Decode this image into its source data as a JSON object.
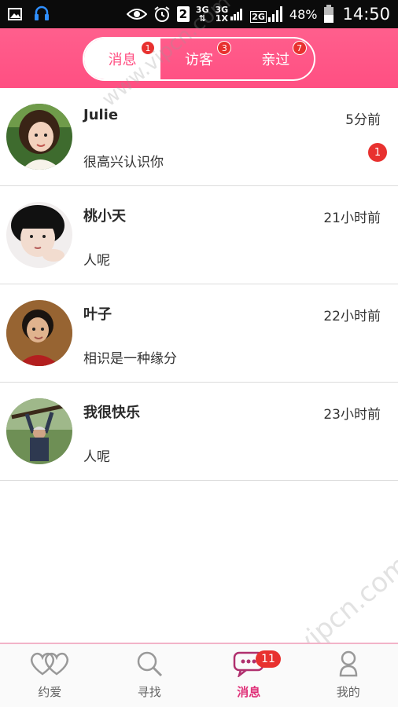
{
  "status_bar": {
    "network_3g_a": "3G",
    "network_3g_b": "3G",
    "network_1x": "1X",
    "network_2g": "2G",
    "sim_slot": "2",
    "battery": "48%",
    "time": "14:50"
  },
  "header": {
    "tabs": [
      {
        "label": "消息",
        "badge": "1"
      },
      {
        "label": "访客",
        "badge": "3"
      },
      {
        "label": "亲过",
        "badge": "7"
      }
    ]
  },
  "conversations": [
    {
      "name": "Julie",
      "time": "5分前",
      "message": "很高兴认识你",
      "unread": "1"
    },
    {
      "name": "桃小天",
      "time": "21小时前",
      "message": "人呢"
    },
    {
      "name": "叶子",
      "time": "22小时前",
      "message": "相识是一种缘分"
    },
    {
      "name": "我很快乐",
      "time": "23小时前",
      "message": "人呢"
    }
  ],
  "watermark": "www.vipcn.com",
  "bottom_nav": {
    "items": [
      {
        "label": "约爱",
        "icon": "hearts-icon"
      },
      {
        "label": "寻找",
        "icon": "search-icon"
      },
      {
        "label": "消息",
        "icon": "chat-icon",
        "badge": "11"
      },
      {
        "label": "我的",
        "icon": "person-icon"
      }
    ]
  },
  "colors": {
    "brand_pink": "#ff4f82",
    "badge_red": "#e8312f"
  }
}
